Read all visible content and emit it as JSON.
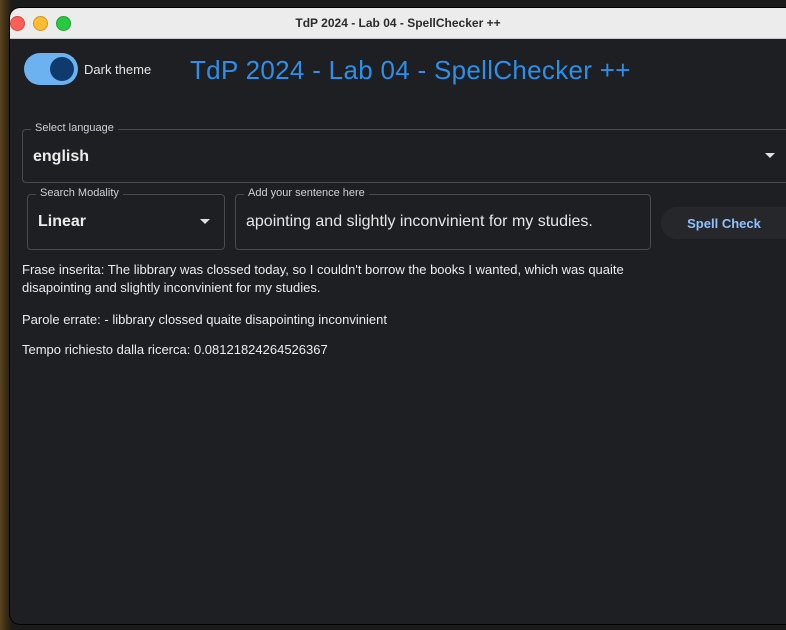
{
  "window": {
    "title": "TdP 2024 - Lab 04 - SpellChecker ++"
  },
  "header": {
    "theme_toggle_label": "Dark theme",
    "app_title": "TdP 2024 - Lab 04 - SpellChecker ++"
  },
  "language": {
    "legend": "Select language",
    "value": "english"
  },
  "modality": {
    "legend": "Search Modality",
    "value": "Linear"
  },
  "sentence": {
    "legend": "Add your sentence here",
    "value": "apointing and slightly inconvinient for my studies."
  },
  "actions": {
    "spell_check_label": "Spell Check"
  },
  "output": {
    "frase_line1": "Frase inserita: The libbrary was clossed today, so I couldn't borrow the books I wanted, which was quaite",
    "frase_line2": "disapointing and slightly inconvinient for my studies.",
    "parole": "Parole errate:  - libbrary clossed quaite disapointing inconvinient",
    "tempo": "Tempo richiesto dalla ricerca: 0.08121824264526367"
  },
  "colors": {
    "accent": "#2e8fe8",
    "background": "#1e1f22",
    "toggle_track": "#6cb2f0"
  },
  "theme_toggle_on": true
}
